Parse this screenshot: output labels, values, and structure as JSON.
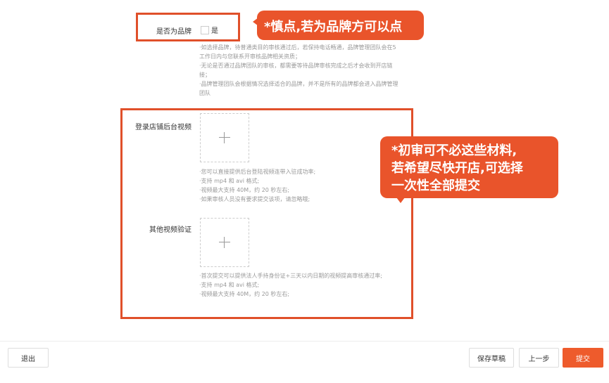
{
  "brand": {
    "label": "是否为品牌",
    "option_label": "是",
    "notes": [
      "·如选择品牌，待普通类目的审核通过后，若保持电话畅通，品牌管理团队会在5",
      "工作日内与您联系开审核品牌相关资质；",
      "·无论是否通过品牌团队的审核，都需要等待品牌审核完成之后才会收到开店链",
      "接；",
      "·品牌管理团队会根据情况选择适合的品牌，并不是所有的品牌都会进入品牌管理",
      "团队"
    ]
  },
  "video_login": {
    "label": "登录店铺后台视频",
    "notes": [
      "·您可以直接提供后台登陆视频连带入驻成功率;",
      "·支持 mp4 和 avi 格式;",
      "·视频最大支持 40M，约 20 秒左右;",
      "·如果审核人员没有要求提交该项，请忽略哦;"
    ]
  },
  "video_other": {
    "label": "其他视频验证",
    "notes": [
      "·首次提交可以提供法人手持身份证+三天以内日期的视频提高审核通过率;",
      "·支持 mp4 和 avi 格式;",
      "·视频最大支持 40M，约 20 秒左右;"
    ]
  },
  "callouts": {
    "top": "*慎点,若为品牌方可以点",
    "middle_lines": [
      "*初审可不必这些材料,",
      "若希望尽快开店,可选择",
      "一次性全部提交"
    ]
  },
  "footer": {
    "exit_label": "退出",
    "save_draft_label": "保存草稿",
    "prev_label": "上一步",
    "submit_label": "提交"
  },
  "colors": {
    "accent": "#e9542b",
    "primary_button": "#ee5b2c"
  }
}
